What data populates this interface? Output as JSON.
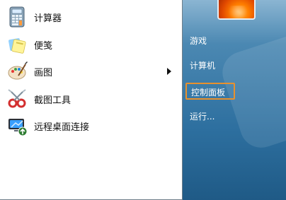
{
  "start_menu": {
    "programs": [
      {
        "label": "计算器",
        "icon": "calculator-icon"
      },
      {
        "label": "便笺",
        "icon": "sticky-notes-icon"
      },
      {
        "label": "画图",
        "icon": "paint-icon",
        "has_submenu": true
      },
      {
        "label": "截图工具",
        "icon": "snipping-tool-icon"
      },
      {
        "label": "远程桌面连接",
        "icon": "remote-desktop-icon"
      }
    ],
    "right_links": [
      {
        "label": "游戏"
      },
      {
        "label": "计算机"
      },
      {
        "label": "控制面板",
        "highlighted": true
      },
      {
        "label": "运行..."
      }
    ],
    "colors": {
      "highlight_border": "#e8912d"
    }
  }
}
